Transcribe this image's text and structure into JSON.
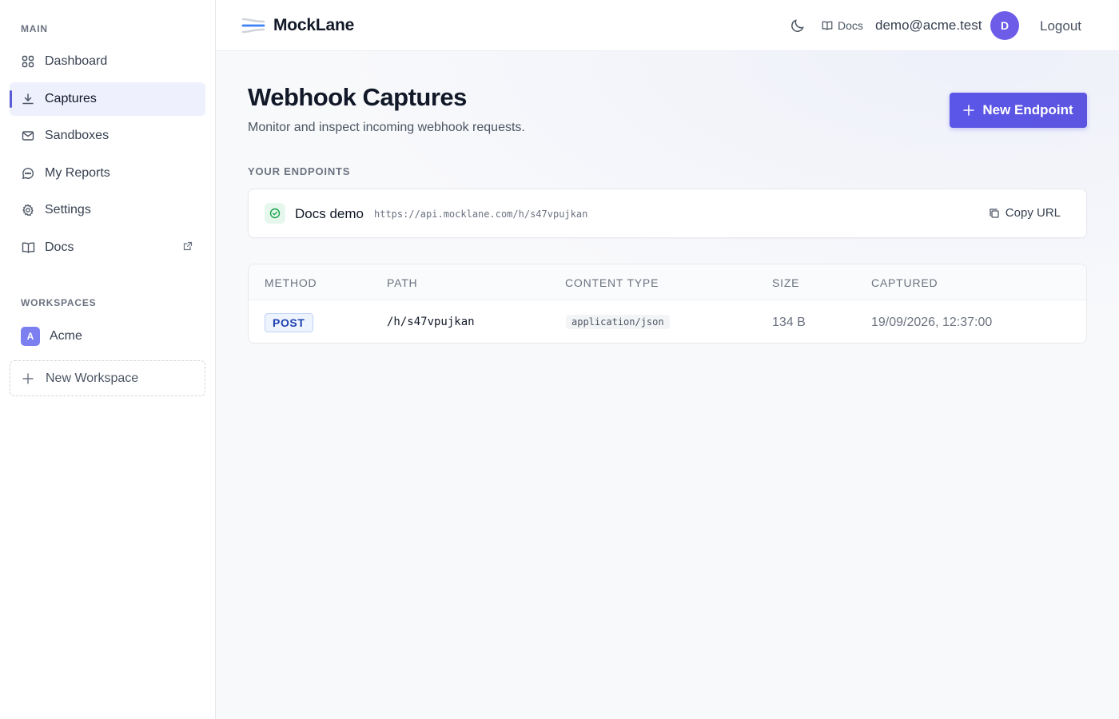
{
  "sidebar": {
    "main_label": "MAIN",
    "items": [
      {
        "label": "Dashboard",
        "icon": "grid-icon"
      },
      {
        "label": "Captures",
        "icon": "download-icon",
        "active": true
      },
      {
        "label": "Sandboxes",
        "icon": "mail-icon"
      },
      {
        "label": "My Reports",
        "icon": "chat-icon"
      },
      {
        "label": "Settings",
        "icon": "gear-icon"
      },
      {
        "label": "Docs",
        "icon": "book-icon",
        "external": true
      }
    ],
    "workspaces_label": "WORKSPACES",
    "workspace": {
      "initial": "A",
      "name": "Acme"
    },
    "new_workspace_label": "New Workspace"
  },
  "header": {
    "brand": "MockLane",
    "docs_label": "Docs",
    "email": "demo@acme.test",
    "avatar_initial": "D",
    "logout_label": "Logout"
  },
  "page": {
    "title": "Webhook Captures",
    "subtitle": "Monitor and inspect incoming webhook requests.",
    "new_endpoint_label": "New Endpoint",
    "endpoints_label": "YOUR ENDPOINTS"
  },
  "endpoint": {
    "name": "Docs demo",
    "url": "https://api.mocklane.com/h/s47vpujkan",
    "copy_label": "Copy URL"
  },
  "table": {
    "columns": [
      "METHOD",
      "PATH",
      "CONTENT TYPE",
      "SIZE",
      "CAPTURED"
    ],
    "rows": [
      {
        "method": "POST",
        "path": "/h/s47vpujkan",
        "content_type": "application/json",
        "size": "134 B",
        "captured": "19/09/2026, 12:37:00"
      }
    ]
  },
  "colors": {
    "accent": "#5b56e8",
    "active_bg": "#eef0fd",
    "success": "#16a34a"
  }
}
